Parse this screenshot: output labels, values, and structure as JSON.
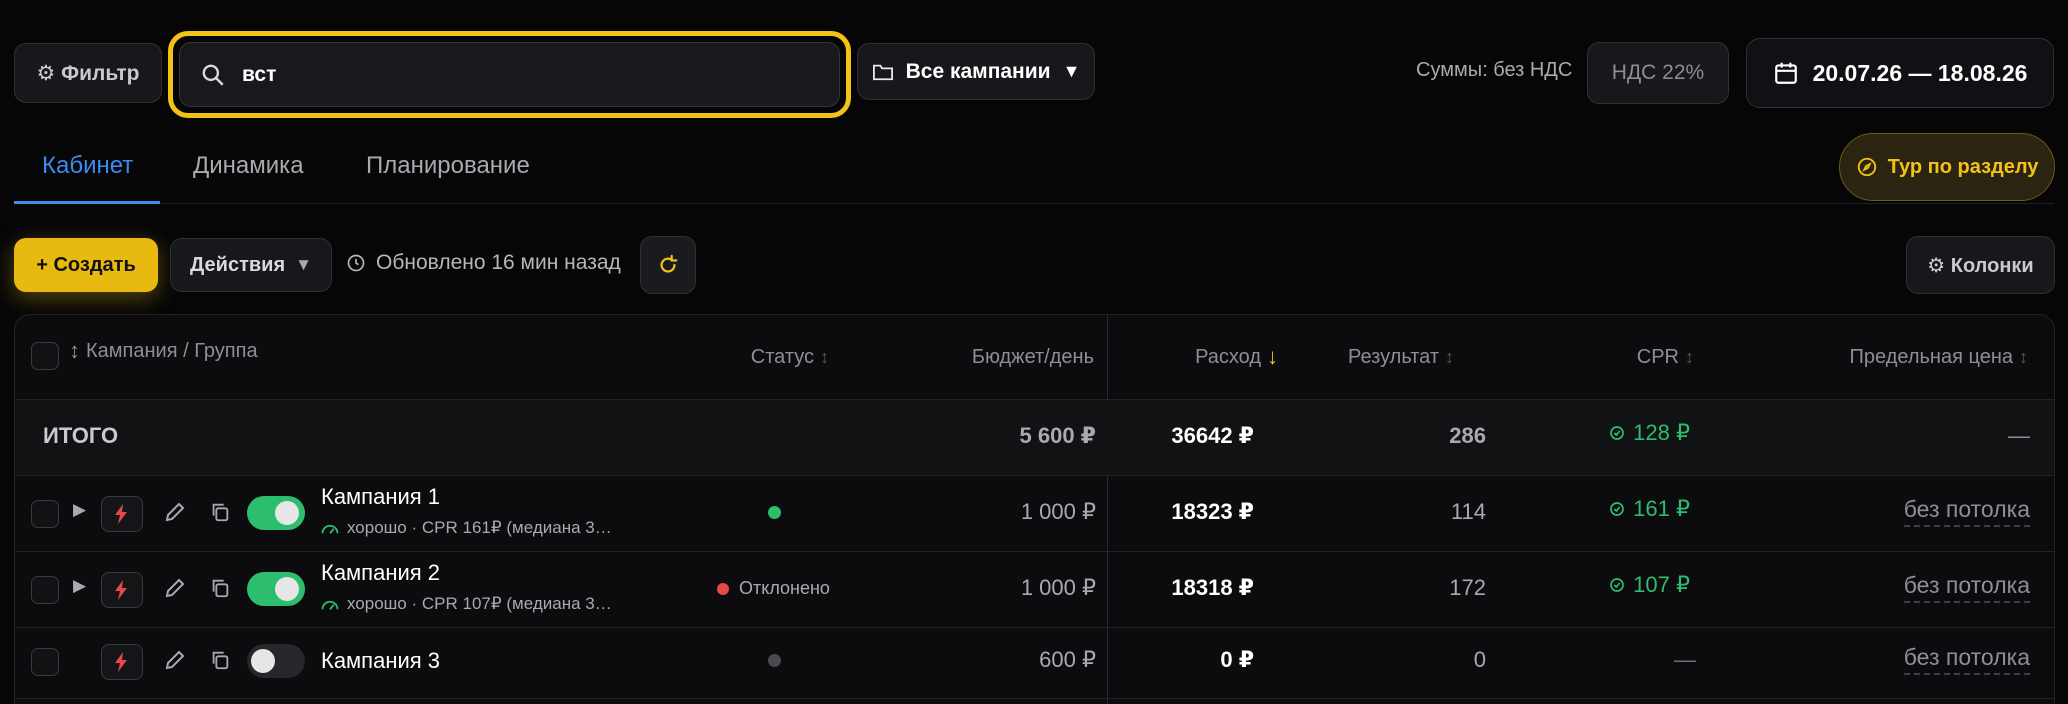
{
  "toolbar": {
    "filter_label": "⚙ Фильтр",
    "search_value": "вст",
    "campaigns_label": "Все кампании",
    "sums_label": "Суммы: без НДС",
    "nds_label": "НДС 22%",
    "date_range": "20.07.26 — 18.08.26"
  },
  "tabs": [
    {
      "label": "Кабинет",
      "active": true
    },
    {
      "label": "Динамика",
      "active": false
    },
    {
      "label": "Планирование",
      "active": false
    }
  ],
  "tour_label": "Тур по разделу",
  "actions_row": {
    "create_label": "+ Создать",
    "actions_label": "Действия",
    "updated_text": "Обновлено 16 мин назад",
    "columns_label": "⚙ Колонки"
  },
  "table": {
    "headers": {
      "campaign": "Кампания / Группа",
      "status": "Статус",
      "budget": "Бюджет/день",
      "spend": "Расход",
      "result": "Результат",
      "cpr": "CPR",
      "ceiling": "Предельная цена"
    },
    "total": {
      "label": "ИТОГО",
      "budget": "5 600 ₽",
      "spend": "36642 ₽",
      "result": "286",
      "cpr": "128 ₽",
      "ceiling": "—"
    },
    "rows": [
      {
        "name": "Кампания 1",
        "sub": "хорошо · CPR 161₽ (медиана 3…",
        "status": "",
        "budget": "1 000 ₽",
        "spend": "18323 ₽",
        "result": "114",
        "cpr": "161 ₽",
        "ceiling": "без потолка"
      },
      {
        "name": "Кампания 2",
        "sub": "хорошо · CPR 107₽ (медиана 3…",
        "status": "Отклонено",
        "budget": "1 000 ₽",
        "spend": "18318 ₽",
        "result": "172",
        "cpr": "107 ₽",
        "ceiling": "без потолка"
      },
      {
        "name": "Кампания 3",
        "sub": "",
        "status": "",
        "budget": "600 ₽",
        "spend": "0 ₽",
        "result": "0",
        "cpr": "—",
        "ceiling": "без потолка"
      }
    ]
  },
  "colors": {
    "accent_yellow": "#f2c316",
    "active_tab_blue": "#3d8bf0",
    "success_green": "#2dbd6e",
    "danger_red": "#e5484d"
  }
}
